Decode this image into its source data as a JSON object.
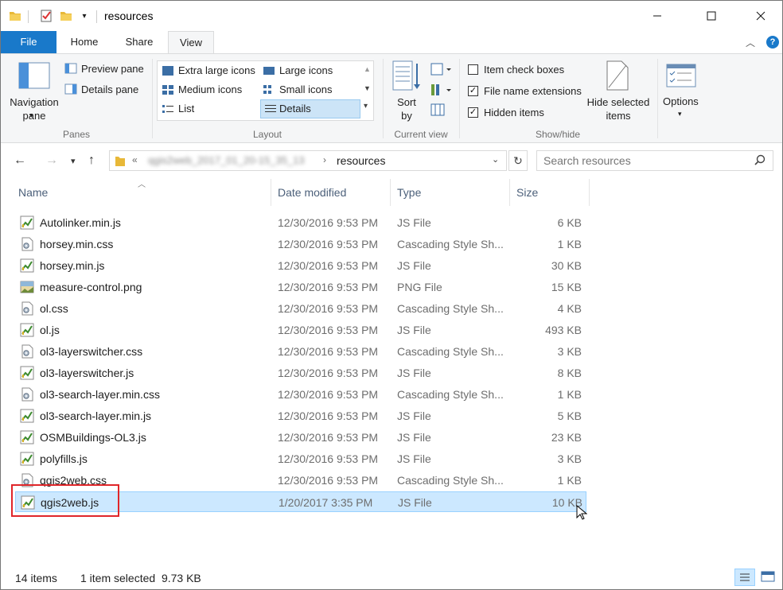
{
  "window": {
    "title": "resources"
  },
  "tabs": {
    "file": "File",
    "home": "Home",
    "share": "Share",
    "view": "View"
  },
  "ribbon": {
    "panes": {
      "navigation_pane": "Navigation pane",
      "preview_pane": "Preview pane",
      "details_pane": "Details pane",
      "label": "Panes"
    },
    "layout": {
      "extra_large_icons": "Extra large icons",
      "large_icons": "Large icons",
      "medium_icons": "Medium icons",
      "small_icons": "Small icons",
      "list": "List",
      "details": "Details",
      "label": "Layout"
    },
    "current_view": {
      "sort_by": "Sort by",
      "label": "Current view"
    },
    "show_hide": {
      "item_check_boxes": "Item check boxes",
      "file_name_extensions": "File name extensions",
      "hidden_items": "Hidden items",
      "item_check_boxes_checked": false,
      "file_name_extensions_checked": true,
      "hidden_items_checked": true,
      "hide_selected_items": "Hide selected items",
      "label": "Show/hide"
    },
    "options": "Options"
  },
  "address": {
    "path_blurred": "qgis2web_2017_01_20-15_35_13",
    "current": "resources"
  },
  "search": {
    "placeholder": "Search resources"
  },
  "columns": {
    "name": "Name",
    "date": "Date modified",
    "type": "Type",
    "size": "Size"
  },
  "files": [
    {
      "name": "Autolinker.min.js",
      "date": "12/30/2016 9:53 PM",
      "type": "JS File",
      "size": "6 KB",
      "icon": "js-file-icon"
    },
    {
      "name": "horsey.min.css",
      "date": "12/30/2016 9:53 PM",
      "type": "Cascading Style Sh...",
      "size": "1 KB",
      "icon": "css-file-icon"
    },
    {
      "name": "horsey.min.js",
      "date": "12/30/2016 9:53 PM",
      "type": "JS File",
      "size": "30 KB",
      "icon": "js-file-icon"
    },
    {
      "name": "measure-control.png",
      "date": "12/30/2016 9:53 PM",
      "type": "PNG File",
      "size": "15 KB",
      "icon": "png-file-icon"
    },
    {
      "name": "ol.css",
      "date": "12/30/2016 9:53 PM",
      "type": "Cascading Style Sh...",
      "size": "4 KB",
      "icon": "css-file-icon"
    },
    {
      "name": "ol.js",
      "date": "12/30/2016 9:53 PM",
      "type": "JS File",
      "size": "493 KB",
      "icon": "js-file-icon"
    },
    {
      "name": "ol3-layerswitcher.css",
      "date": "12/30/2016 9:53 PM",
      "type": "Cascading Style Sh...",
      "size": "3 KB",
      "icon": "css-file-icon"
    },
    {
      "name": "ol3-layerswitcher.js",
      "date": "12/30/2016 9:53 PM",
      "type": "JS File",
      "size": "8 KB",
      "icon": "js-file-icon"
    },
    {
      "name": "ol3-search-layer.min.css",
      "date": "12/30/2016 9:53 PM",
      "type": "Cascading Style Sh...",
      "size": "1 KB",
      "icon": "css-file-icon"
    },
    {
      "name": "ol3-search-layer.min.js",
      "date": "12/30/2016 9:53 PM",
      "type": "JS File",
      "size": "5 KB",
      "icon": "js-file-icon"
    },
    {
      "name": "OSMBuildings-OL3.js",
      "date": "12/30/2016 9:53 PM",
      "type": "JS File",
      "size": "23 KB",
      "icon": "js-file-icon"
    },
    {
      "name": "polyfills.js",
      "date": "12/30/2016 9:53 PM",
      "type": "JS File",
      "size": "3 KB",
      "icon": "js-file-icon"
    },
    {
      "name": "qgis2web.css",
      "date": "12/30/2016 9:53 PM",
      "type": "Cascading Style Sh...",
      "size": "1 KB",
      "icon": "css-file-icon"
    },
    {
      "name": "qgis2web.js",
      "date": "1/20/2017 3:35 PM",
      "type": "JS File",
      "size": "10 KB",
      "icon": "js-file-icon",
      "selected": true
    }
  ],
  "status": {
    "items": "14 items",
    "selection": "1 item selected  9.73 KB"
  },
  "colors": {
    "accent": "#1979ca",
    "selection": "#cce8ff",
    "highlight": "#e0262a"
  }
}
